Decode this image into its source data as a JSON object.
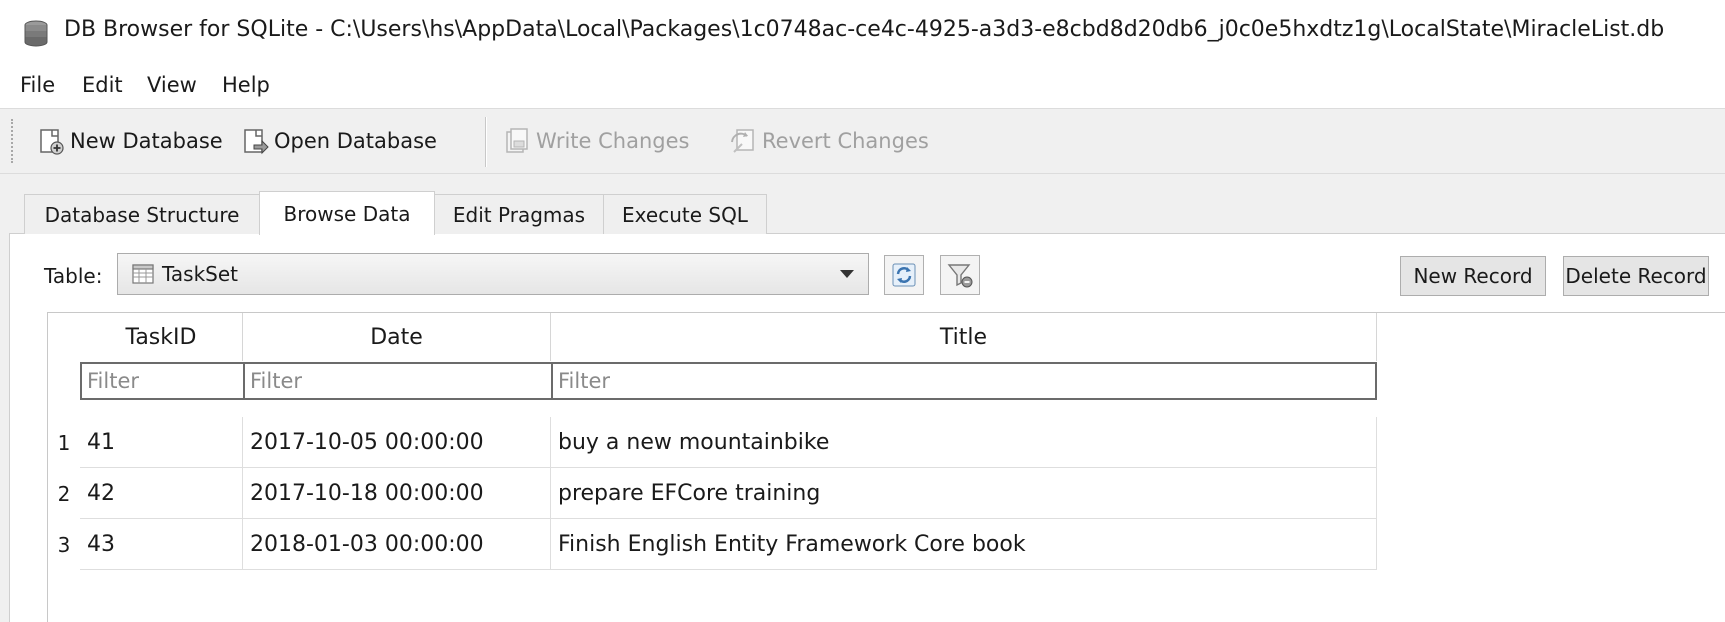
{
  "window": {
    "title": "DB Browser for SQLite - C:\\Users\\hs\\AppData\\Local\\Packages\\1c0748ac-ce4c-4925-a3d3-e8cbd8d20db6_j0c0e5hxdtz1g\\LocalState\\MiracleList.db",
    "icon": "database-icon"
  },
  "menu": [
    "File",
    "Edit",
    "View",
    "Help"
  ],
  "toolbar": {
    "new_database": "New Database",
    "open_database": "Open Database",
    "write_changes": "Write Changes",
    "revert_changes": "Revert Changes"
  },
  "tabs": [
    "Database Structure",
    "Browse Data",
    "Edit Pragmas",
    "Execute SQL"
  ],
  "active_tab": "Browse Data",
  "browse": {
    "table_label": "Table:",
    "table_selected": "TaskSet",
    "refresh_icon": "refresh-icon",
    "clear_filters_icon": "clear-filter-icon",
    "new_record": "New Record",
    "delete_record": "Delete Record"
  },
  "grid": {
    "columns": [
      "TaskID",
      "Date",
      "Title"
    ],
    "filter_placeholder": "Filter",
    "rows": [
      {
        "num": "1",
        "TaskID": "41",
        "Date": "2017-10-05 00:00:00",
        "Title": "buy a new mountainbike"
      },
      {
        "num": "2",
        "TaskID": "42",
        "Date": "2017-10-18 00:00:00",
        "Title": "prepare EFCore training"
      },
      {
        "num": "3",
        "TaskID": "43",
        "Date": "2018-01-03 00:00:00",
        "Title": "Finish English Entity Framework Core book"
      }
    ]
  },
  "colors": {
    "window_bg": "#f0f0f0",
    "panel_bg": "#ffffff",
    "disabled_text": "#a0a0a0"
  }
}
